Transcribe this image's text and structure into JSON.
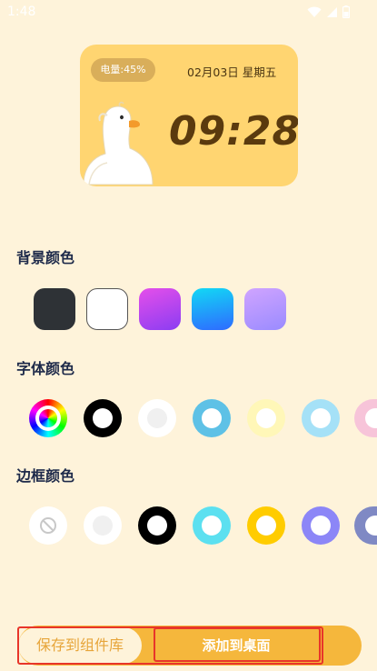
{
  "status_bar": {
    "time": "1:48"
  },
  "widget": {
    "battery_label": "电量:45%",
    "date": "02月03日",
    "weekday": "星期五",
    "time": "09:28",
    "background_color": "#FFD571"
  },
  "sections": {
    "background_color_title": "背景颜色",
    "font_color_title": "字体颜色",
    "border_color_title": "边框颜色"
  },
  "background_swatches": [
    {
      "name": "dark-gray",
      "color": "#2E3236"
    },
    {
      "name": "white",
      "color": "#FFFFFF"
    },
    {
      "name": "pink-purple-gradient",
      "color": "#C24CF0"
    },
    {
      "name": "cyan-blue-gradient",
      "color": "#1AA3FF"
    },
    {
      "name": "lavender-gradient",
      "color": "#B690FF"
    }
  ],
  "font_colors": [
    {
      "name": "custom-color-wheel",
      "color": "rainbow"
    },
    {
      "name": "black",
      "color": "#000000"
    },
    {
      "name": "white",
      "color": "#F3F3F3"
    },
    {
      "name": "sky-blue",
      "color": "#5EC1E6"
    },
    {
      "name": "pale-yellow",
      "color": "#FFF7B8"
    },
    {
      "name": "light-blue",
      "color": "#A5E1F7"
    },
    {
      "name": "pink",
      "color": "#F7C4D9"
    }
  ],
  "border_colors": [
    {
      "name": "none",
      "color": "none"
    },
    {
      "name": "white",
      "color": "#F3F3F3"
    },
    {
      "name": "black",
      "color": "#000000"
    },
    {
      "name": "cyan",
      "color": "#5CE0F0"
    },
    {
      "name": "yellow",
      "color": "#FFCC00"
    },
    {
      "name": "purple",
      "color": "#8C86F7"
    },
    {
      "name": "slate-blue",
      "color": "#7F89C4"
    }
  ],
  "actions": {
    "save_label": "保存到组件库",
    "add_label": "添加到桌面"
  },
  "colors": {
    "page_background": "#FEF3DA",
    "accent": "#F5B73C",
    "highlight_border": "#E8352A"
  }
}
